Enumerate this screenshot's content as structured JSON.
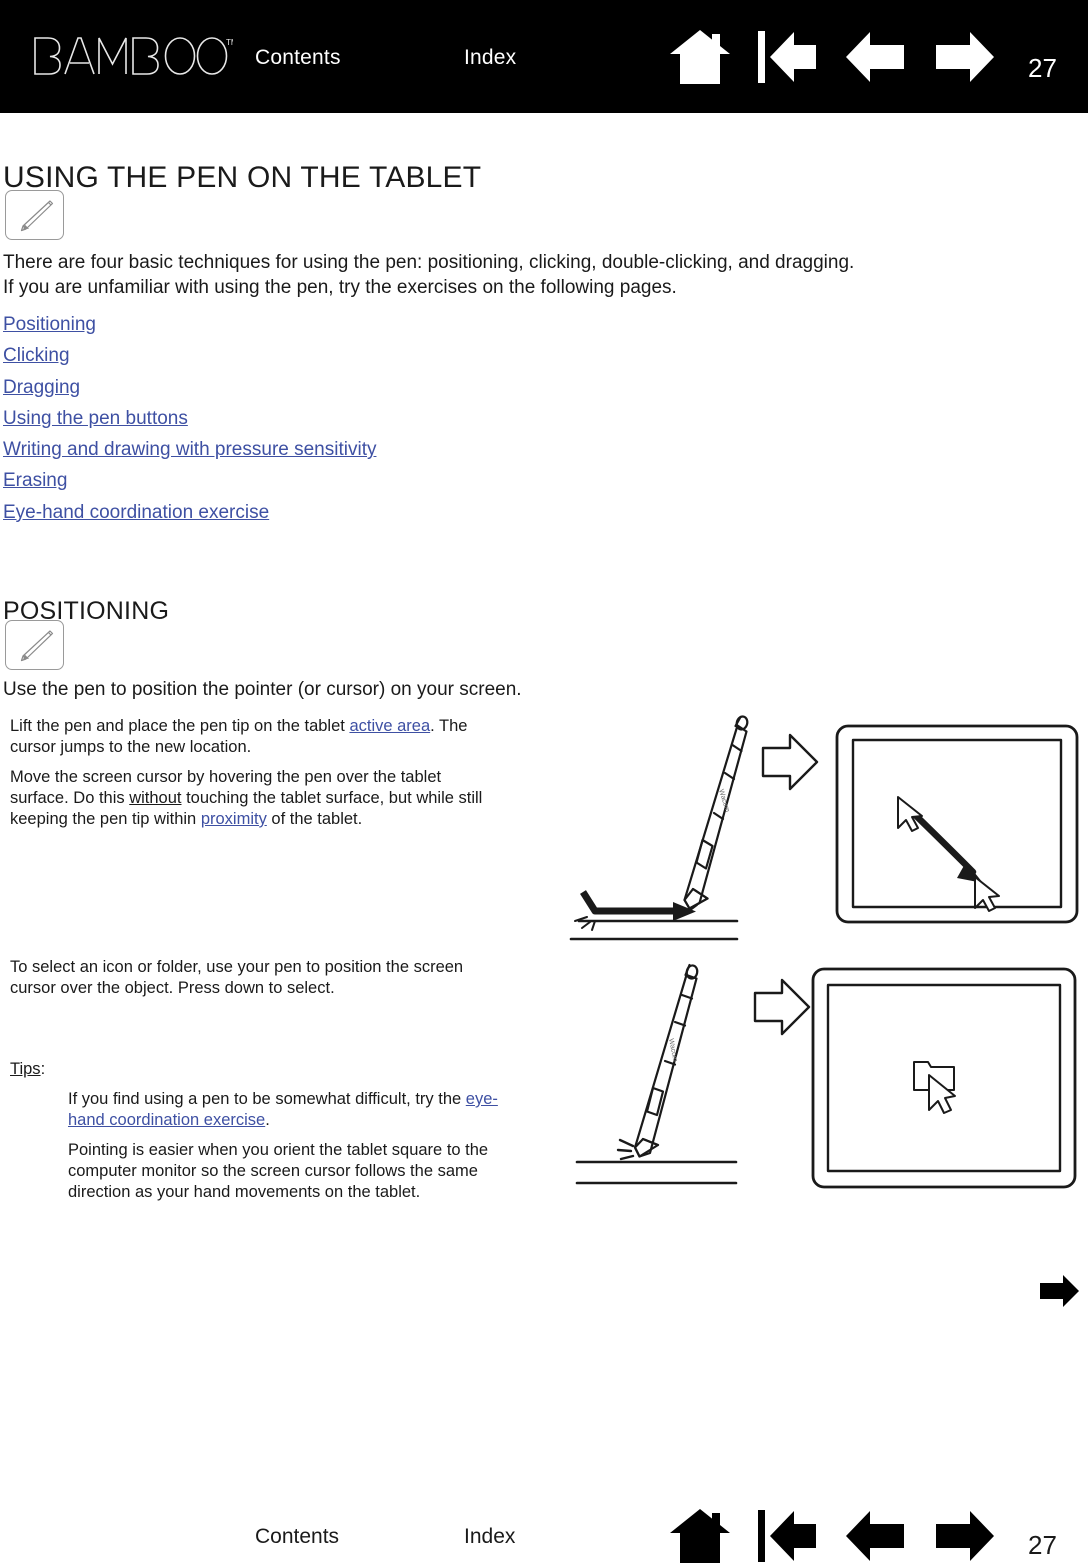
{
  "header": {
    "logo_text": "BAMBOO",
    "logo_tm": "™",
    "contents_label": "Contents",
    "index_label": "Index",
    "page_number": "27",
    "icons": [
      "home-icon",
      "first-page-icon",
      "previous-page-icon",
      "next-page-icon"
    ]
  },
  "page": {
    "title": "USING THE PEN ON THE TABLET",
    "intro_line_1": "There are four basic techniques for using the pen: positioning, clicking, double-clicking, and dragging.",
    "intro_line_2": "If you are unfamiliar with using the pen, try the exercises on the following pages.",
    "links": [
      "Positioning",
      "Clicking",
      "Dragging",
      "Using the pen buttons",
      "Writing and drawing with pressure sensitivity",
      "Erasing",
      "Eye-hand coordination exercise"
    ],
    "section_title": "POSITIONING",
    "section_lead": "Use the pen to position the pointer (or cursor) on your screen.",
    "para_1": {
      "before_link": "Lift the pen and place the pen tip on the tablet ",
      "link": "active area",
      "after_link": ".  The cursor jumps to the new location."
    },
    "para_2": {
      "part_1": "Move the screen cursor by hovering the pen over the tablet surface.  Do this ",
      "underline_1": "without",
      "part_2": " touching the tablet surface, but while still keeping the pen tip within ",
      "link_1": "proximity",
      "part_3": " of the tablet."
    },
    "para_3": "To select an icon or folder, use your pen to position the screen cursor over the object.  Press down to select.",
    "tips_label": "Tips",
    "tips_colon": ":",
    "tip_1": {
      "before_link": "If you find using a pen to be somewhat difficult, try the ",
      "link": "eye-hand coordination exercise",
      "after_link": "."
    },
    "tip_2": "Pointing is easier when you orient the tablet square to the computer monitor so the screen cursor follows the same direction as your hand movements on the tablet."
  },
  "illustrations": {
    "top": {
      "name": "pen-hovering-over-tablet-moves-cursor",
      "pen_label": "Wacom",
      "flow_icon": "right-arrow-outline-icon",
      "screen_content": "cursor-moves-along-arc"
    },
    "bottom": {
      "name": "pen-press-selects-folder",
      "pen_label": "Wacom",
      "flow_icon": "right-arrow-outline-icon",
      "screen_content": "folder-icon-with-cursor"
    }
  },
  "forward_arrow": "next-page-arrow-icon",
  "footer": {
    "contents_label": "Contents",
    "index_label": "Index",
    "page_number": "27",
    "icons": [
      "home-icon",
      "first-page-icon",
      "previous-page-icon",
      "next-page-icon"
    ]
  },
  "colors": {
    "header_bg": "#000000",
    "header_text": "#ffffff",
    "body_text": "#1a1a1a",
    "link": "#3e50a3",
    "illustration_stroke": "#1a1a1a"
  }
}
